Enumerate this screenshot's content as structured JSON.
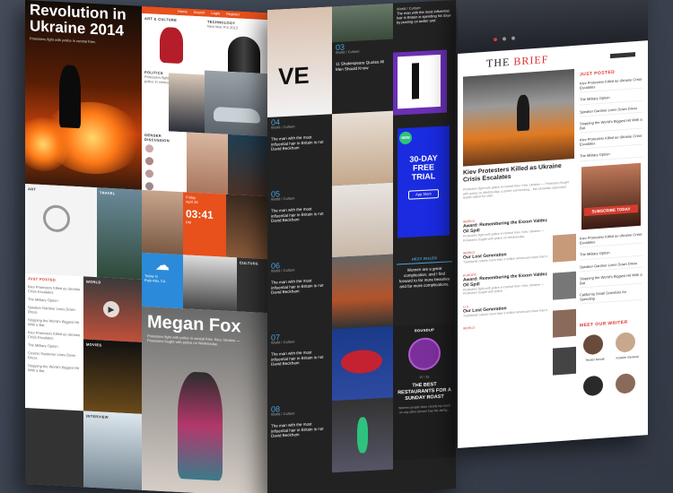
{
  "panel1": {
    "hero_title": "Revolution in Ukraine 2014",
    "hero_subtitle": "Protesters fight with police in central Kiev.",
    "topbar_items": [
      "Home",
      "Search",
      "Login",
      "Register"
    ],
    "art_culture_label": "ART & CULTURE",
    "technology_label": "TECHNOLOGY",
    "technology_text": "New Mac Pro 2013",
    "politics_label": "POLITICS",
    "politics_text": "Protesters fight with police in central Kiev",
    "gender_discussion_label": "GENDER DISCUSSION",
    "art_label": "ART",
    "travel_label": "TRAVEL",
    "just_posted_label": "JUST POSTED",
    "world_label": "WORLD",
    "movies_label": "MOVIES",
    "interview_label": "INTERVIEW",
    "date_day": "Friday",
    "date": "April 25",
    "time": "03:41",
    "time_suffix": "PM",
    "weather_temp": "Today in",
    "weather_city": "Palo Alto, CA",
    "culture_label": "CULTURE",
    "feature_name": "Megan Fox",
    "feature_text": "Protesters fight with police in central Kiev. Kiev, Ukraine — Protesters fought with police on Wednesday.",
    "just_posted_items": [
      "Kiev Protesters Killed as Ukraine Crisis Escalates",
      "The Military Option",
      "Speaker Gardner Lines Down Dress",
      "Stopping the World's Biggest Hit With a Bat",
      "Kiev Protesters Killed as Ukraine Crisis Escalates",
      "The Military Option",
      "Cosmic Gardener Lines Down Dress",
      "Stopping the World's Biggest Hit With a Bat"
    ]
  },
  "panel2": {
    "top_text": "The man with the most influential hair in Britain is spending his days by posting on twitter and",
    "top_meta": "World / Culture",
    "items": [
      {
        "num": "03",
        "meta": "World / Culture",
        "title": "11 Shakespeare Quotes All Men Should Know"
      },
      {
        "num": "04",
        "meta": "World / Culture",
        "title": "The man with the most influential hair in Britain is not David Beckham"
      },
      {
        "num": "05",
        "meta": "World / Culture",
        "title": "The man with the most influential hair in Britain is not David Beckham"
      },
      {
        "num": "06",
        "meta": "World / Culture",
        "title": "The man with the most influential hair in Britain is not David Beckham"
      },
      {
        "num": "07",
        "meta": "World / Culture",
        "title": "The man with the most influential hair in Britain is not David Beckham"
      },
      {
        "num": "08",
        "meta": "World / Culture",
        "title": "The man with the most influential hair in Britain is not David Beckham"
      }
    ],
    "badge": "NEW",
    "trial_line1": "30-DAY",
    "trial_line2": "FREE",
    "trial_line3": "TRIAL",
    "appstore": "App Store",
    "hezy_label": "HEZY RULES",
    "hezy_text": "Women are a great complication, and I find forward to far more beauties and far more complications.",
    "roundup_label": "ROUNDUP",
    "roundup_count": "97 / 10",
    "roundup_title": "THE BEST RESTAURANTS FOR A SUNDAY ROAST",
    "roundup_text": "Women people have clearly lay claim on any other person has the ability..."
  },
  "panel3": {
    "logo_the": "THE",
    "logo_brief": "BRIEF",
    "headline": "Kiev Protesters Killed as Ukraine Crisis Escalates",
    "headline_text": "Protesters fight with police in central Kiev. Kiev, Ukraine — Protesters fought with police on Wednesday, a police surrounding... the Ukrainian opposition leader called for calm.",
    "just_posted_label": "JUST POSTED",
    "just_posted_items": [
      "Kiev Protesters Killed as Ukraine Crisis Escalates",
      "The Military Option",
      "Speaker Gardner Lines Down Dress",
      "Stopping the World's Biggest Hit With a Bat",
      "Kiev Protesters Killed as Ukraine Crisis Escalates",
      "The Military Option",
      "Cosmic Gardener Lines Down Dress",
      "Stopping the World's Biggest Hit With a Bat"
    ],
    "subscribe": "SUBSCRIBE TODAY",
    "articles": [
      {
        "cat": "WORLD",
        "title": "Award: Remembering the Exxon Valdez Oil Spill",
        "text": "Protesters fight with police in central Kiev. Kiev, Ukraine — Protesters fought with police on Wednesday."
      },
      {
        "cat": "WORLD",
        "title": "Our Lost Generation",
        "text": "Traditional culture more than 3 million Americans have had it."
      },
      {
        "cat": "EUROPE",
        "title": "Award: Remembering the Exxon Valdez Oil Spill",
        "text": "Protesters fight with police in central Kiev. Kiev, Ukraine — Protesters fought with police."
      },
      {
        "cat": "U.S.",
        "title": "Our Lost Generation",
        "text": "Traditional culture more than 3 million Americans have had it."
      },
      {
        "cat": "WORLD",
        "title": "",
        "text": ""
      }
    ],
    "side_items": [
      "Kiev Protesters Killed as Ukraine Crisis Escalates",
      "The Military Option",
      "Speaker Gardner Lines Down Dress",
      "Stopping the World's Biggest Hit With a Bat",
      "California Small Scientists for Spending"
    ],
    "writers_label": "MEET OUR WRITER",
    "writers": [
      {
        "name": "Teodor Novak",
        "role": "Editor"
      },
      {
        "name": "Kristine General",
        "role": "Writer"
      },
      {
        "name": "",
        "role": ""
      },
      {
        "name": "",
        "role": ""
      }
    ]
  },
  "colors": {
    "accent_red": "#d33c2e",
    "accent_orange": "#e8501c",
    "accent_blue": "#4aa3e0",
    "trial_blue": "#1a2be0"
  }
}
